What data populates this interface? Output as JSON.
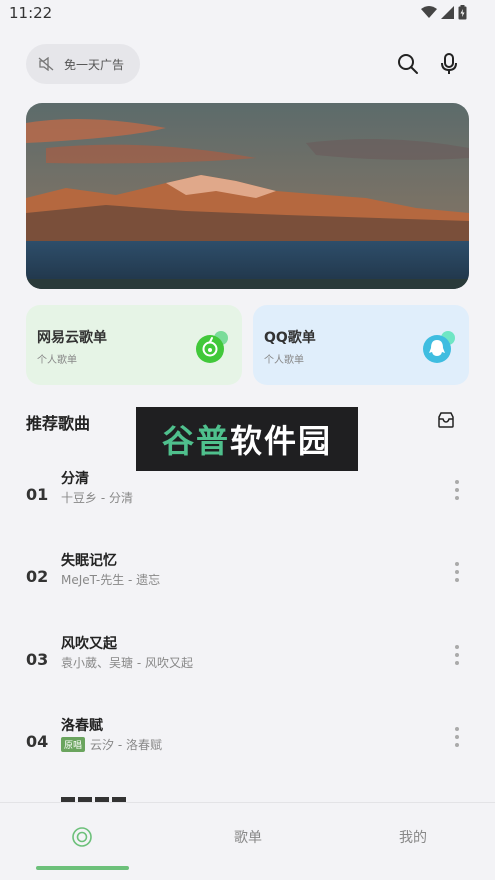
{
  "status": {
    "time": "11:22"
  },
  "search": {
    "ad_label": "免一天广告"
  },
  "cards": [
    {
      "title": "网易云歌单",
      "subtitle": "个人歌单",
      "bg": "#e6f4e6",
      "accent": "#3ec83e"
    },
    {
      "title": "QQ歌单",
      "subtitle": "个人歌单",
      "bg": "#e0eefb",
      "accent": "#3fbde0"
    }
  ],
  "section": {
    "title": "推荐歌曲"
  },
  "watermark": {
    "part1": "谷普",
    "part2": "软件园"
  },
  "songs": [
    {
      "num": "01",
      "title": "分清",
      "artist": "十豆乡 - 分清",
      "tag": ""
    },
    {
      "num": "02",
      "title": "失眠记忆",
      "artist": "MeJeT-先生 - 遗忘",
      "tag": ""
    },
    {
      "num": "03",
      "title": "风吹又起",
      "artist": "袁小葳、吴瑭 - 风吹又起",
      "tag": ""
    },
    {
      "num": "04",
      "title": "洛春赋",
      "artist": "云汐 - 洛春赋",
      "tag": "原唱"
    }
  ],
  "nav": {
    "tab2": "歌单",
    "tab3": "我的",
    "active_color": "#6cc07a"
  },
  "icons": [
    "no-ads-icon",
    "search-icon",
    "mic-icon",
    "netease-icon",
    "qq-icon",
    "box-icon",
    "more-icon",
    "home-icon"
  ]
}
